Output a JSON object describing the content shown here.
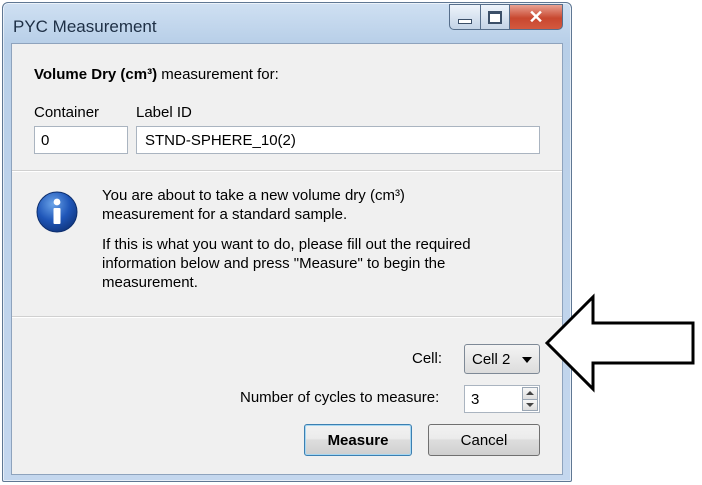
{
  "window": {
    "title": "PYC Measurement"
  },
  "header": {
    "heading_bold": "Volume Dry (cm³)",
    "heading_rest": " measurement for:",
    "container_label": "Container",
    "labelid_label": "Label ID",
    "container_value": "0",
    "labelid_value": "STND-SPHERE_10(2)"
  },
  "info": {
    "icon": "info-icon",
    "line1": "You are about to take a new volume dry (cm³)",
    "line2": "measurement for a standard sample.",
    "line3": "If this is what you want to do, please fill out the required",
    "line4": "information below and press \"Measure\" to begin the",
    "line5": "measurement."
  },
  "form": {
    "cell_label": "Cell:",
    "cell_value": "Cell 2",
    "cycles_label": "Number of cycles to measure:",
    "cycles_value": "3"
  },
  "buttons": {
    "measure": "Measure",
    "cancel": "Cancel"
  },
  "colors": {
    "accent": "#3c7fb1",
    "titlebar": "#cfe0f2",
    "close": "#c8472f"
  }
}
